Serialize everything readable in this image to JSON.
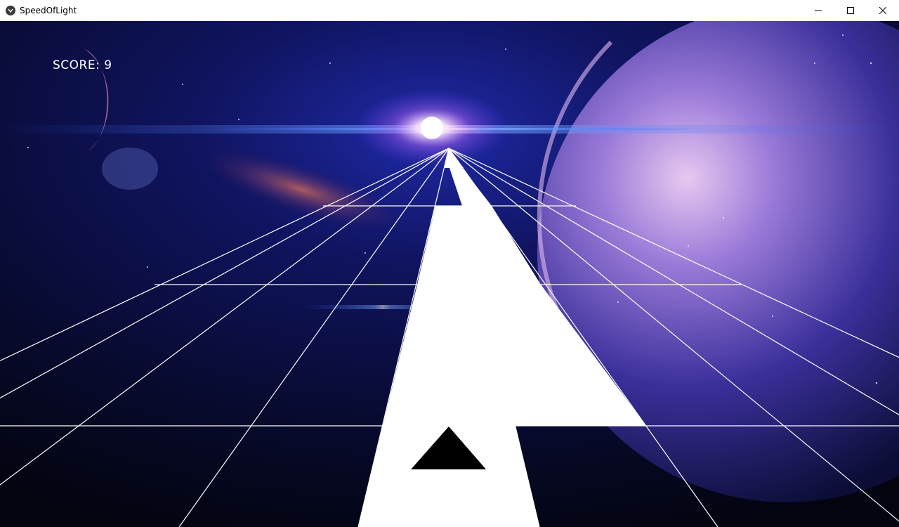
{
  "window": {
    "title": "SpeedOfLight",
    "app_icon": "kivy-icon",
    "controls": [
      "minimize-icon",
      "maximize-icon",
      "close-icon"
    ]
  },
  "hud": {
    "score_label": "SCORE: 9"
  },
  "colors": {
    "space_dark": "#05061a",
    "space_blue": "#1f2aa8",
    "glow": "#ffffff",
    "planet": "#5a4fb5",
    "grid_line": "#ffffff",
    "tile": "#ffffff",
    "ship": "#000000"
  }
}
